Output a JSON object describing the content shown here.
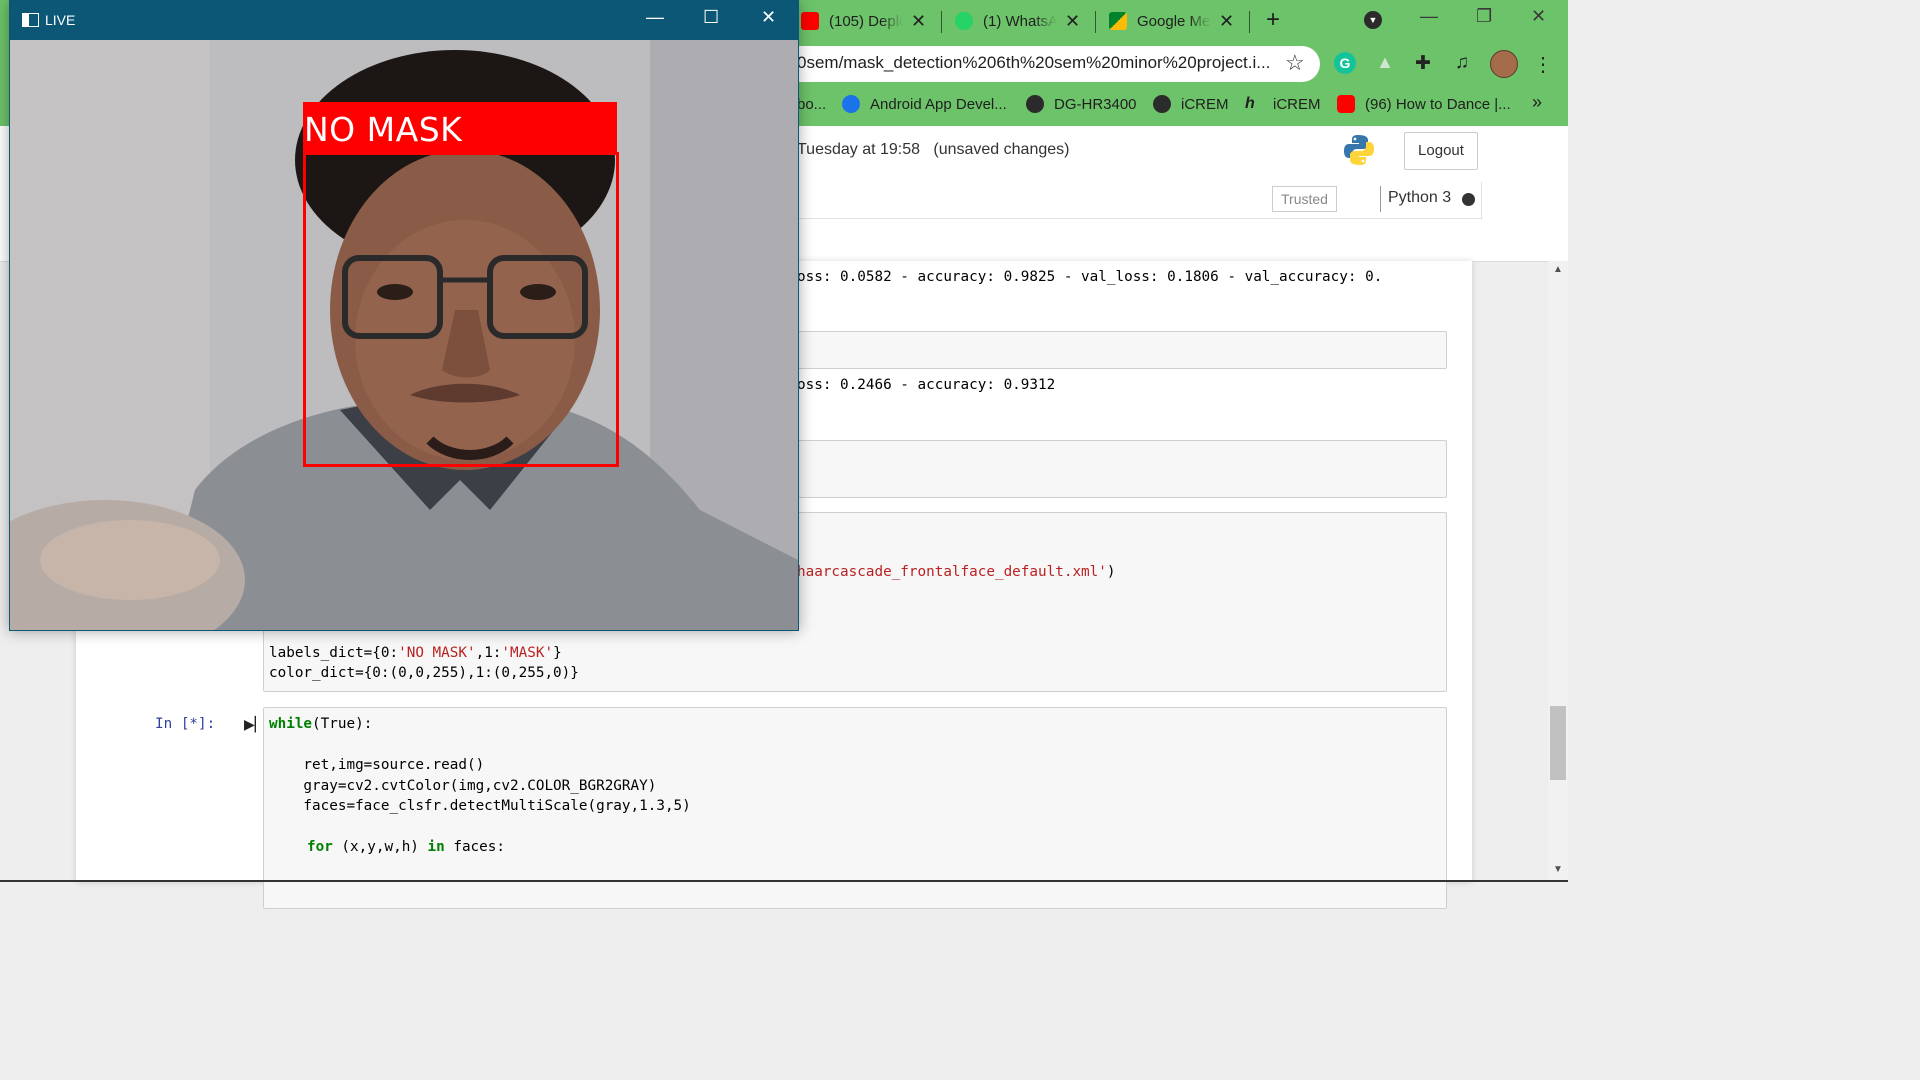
{
  "browser": {
    "tabs": [
      {
        "title": "(105) Deplo",
        "icon": "youtube-icon",
        "color": "#ff0000"
      },
      {
        "title": "(1) WhatsA",
        "icon": "whatsapp-icon",
        "color": "#25d366"
      },
      {
        "title": "Google Me",
        "icon": "google-meet-icon",
        "color": "#00832d"
      }
    ],
    "new_tab_icon": "+",
    "address": "0sem/mask_detection%206th%20sem%20minor%20project.i...",
    "bookmarks": [
      {
        "label": "bo...",
        "icon": "bookmark-icon"
      },
      {
        "label": "Android App Devel...",
        "icon": "android-app-icon"
      },
      {
        "label": "DG-HR3400",
        "icon": "globe-icon"
      },
      {
        "label": "iCREM",
        "icon": "globe-icon"
      },
      {
        "label": "iCREM",
        "icon": "icrem-h-icon"
      },
      {
        "label": "(96) How to Dance |...",
        "icon": "youtube-icon"
      }
    ],
    "accent_color": "#6dc36a"
  },
  "jupyter": {
    "checkpoint": "Tuesday at 19:58   (unsaved changes)",
    "logout_label": "Logout",
    "trusted_label": "Trusted",
    "kernel_name": "Python 3",
    "output_1": "oss: 0.0582 - accuracy: 0.9825 - val_loss: 0.1806 - val_accuracy: 0.",
    "output_2": "oss: 0.2466 - accuracy: 0.9312",
    "cascade_str": "haarcascade_frontalface_default.xml'",
    "cascade_close": ")",
    "code_labels": {
      "line1_a": "labels_dict=",
      "line1_b": "{0:",
      "line1_c": "'NO MASK'",
      "line1_d": ",1:",
      "line1_e": "'MASK'",
      "line1_f": "}",
      "line2_a": "color_dict=",
      "line2_b": "{0:(0,0,255),1:(0,255,0)}"
    },
    "prompt": "In [*]:",
    "code_loop": {
      "while_kw": "while",
      "while_rest": "(True):",
      "true_kw": "True",
      "read_line": "    ret,img=source.read()",
      "gray_line": "    gray=cv2.cvtColor(img,cv2.COLOR_BGR2GRAY)",
      "faces_line": "    faces=face_clsfr.detectMultiScale(gray,1.3,5)",
      "for_kw": "for",
      "for_mid": " (x,y,w,h) ",
      "in_kw": "in",
      "for_end": " faces:"
    }
  },
  "live_window": {
    "title": "LIVE",
    "label": "NO MASK",
    "box_color": "#ff0000"
  }
}
